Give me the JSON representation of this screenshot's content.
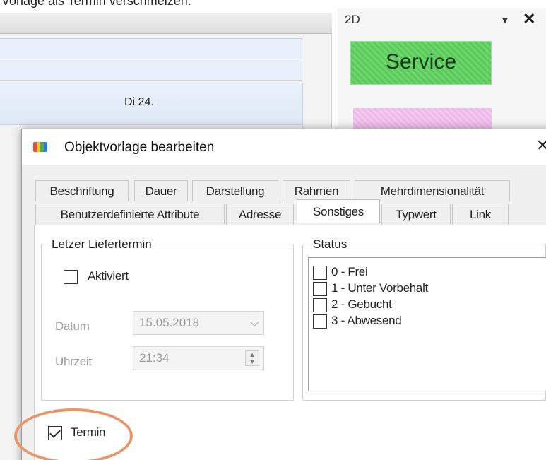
{
  "caption": "Vorlage als Termin verschmelzen.",
  "scheduler": {
    "day_label": "Di 24."
  },
  "panel": {
    "title": "2D",
    "pin_icon": "dropdown-arrow-icon",
    "close": "✕",
    "service_label": "Service"
  },
  "dialog": {
    "title": "Objektvorlage bearbeiten",
    "close": "✕",
    "tabs_row1": [
      "Beschriftung",
      "Dauer",
      "Darstellung",
      "Rahmen",
      "Mehrdimensionalität"
    ],
    "tabs_row2": [
      "Benutzerdefinierte Attribute",
      "Adresse",
      "Sonstiges",
      "Typwert",
      "Link"
    ],
    "active_tab": "Sonstiges"
  },
  "letzter": {
    "group_title": "Letzer Liefertermin",
    "activated_label": "Aktiviert",
    "activated_checked": false,
    "date_label": "Datum",
    "date_value": "15.05.2018",
    "time_label": "Uhrzeit",
    "time_value": "21:34"
  },
  "status": {
    "group_title": "Status",
    "items": [
      "0 - Frei",
      "1 - Unter Vorbehalt",
      "2 - Gebucht",
      "3 - Abwesend"
    ]
  },
  "termin": {
    "label": "Termin",
    "checked": true
  },
  "colors": {
    "service_green": "#5cc95c",
    "highlight_orange": "#e8956a"
  }
}
